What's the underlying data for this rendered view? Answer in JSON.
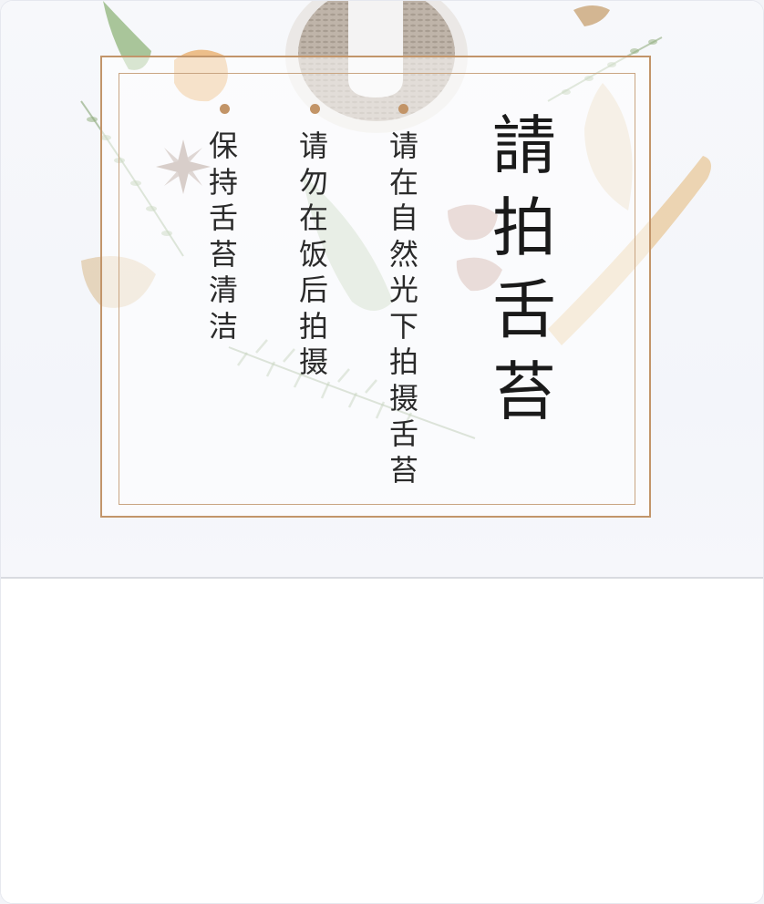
{
  "hero": {
    "title": [
      "請",
      "拍",
      "舌",
      "苔"
    ],
    "tips": [
      {
        "chars": [
          "请",
          "在",
          "自",
          "然",
          "光",
          "下",
          "拍",
          "摄",
          "舌",
          "苔"
        ]
      },
      {
        "chars": [
          "请",
          "勿",
          "在",
          "饭",
          "后",
          "拍",
          "摄"
        ]
      },
      {
        "chars": [
          "保",
          "持",
          "舌",
          "苔",
          "清",
          "洁"
        ]
      }
    ]
  },
  "colors": {
    "frame": "#c2956a",
    "dot": "#c29467",
    "text": "#2a2a2a",
    "title": "#1a1a1a"
  },
  "icons": [
    "herb-decoration",
    "mortar-pestle-decoration",
    "star-anise-decoration"
  ]
}
